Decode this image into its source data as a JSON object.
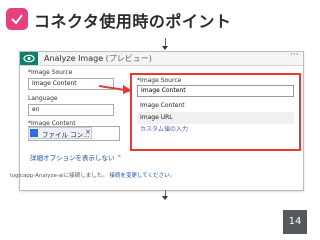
{
  "slide": {
    "title": "コネクタ使用時のポイント",
    "page_number": "14"
  },
  "card": {
    "title": "Analyze Image",
    "title_suffix": "(プレビュー)",
    "more_label": "···",
    "image_source_label": "*Image Source",
    "image_source_value": "Image Content",
    "language_label": "Language",
    "language_value": "en",
    "image_content_label": "*Image Content",
    "file_token_label": "ファイル コン...",
    "file_token_remove": "×",
    "advanced_options_link": "詳細オプションを表示しない ⌃",
    "connection_text": "logicapp-Analyze-aiに接続しました。",
    "change_connection_link": "接続を変更してください。"
  },
  "dropdown": {
    "label": "*Image Source",
    "input_value": "Image Content",
    "options": [
      "Image Content",
      "Image URL",
      "カスタム値の入力"
    ]
  },
  "colors": {
    "accent_pink": "#e8407e",
    "teal": "#0f7f6a",
    "highlight_red": "#e53935",
    "link_blue": "#1a4fa8"
  }
}
